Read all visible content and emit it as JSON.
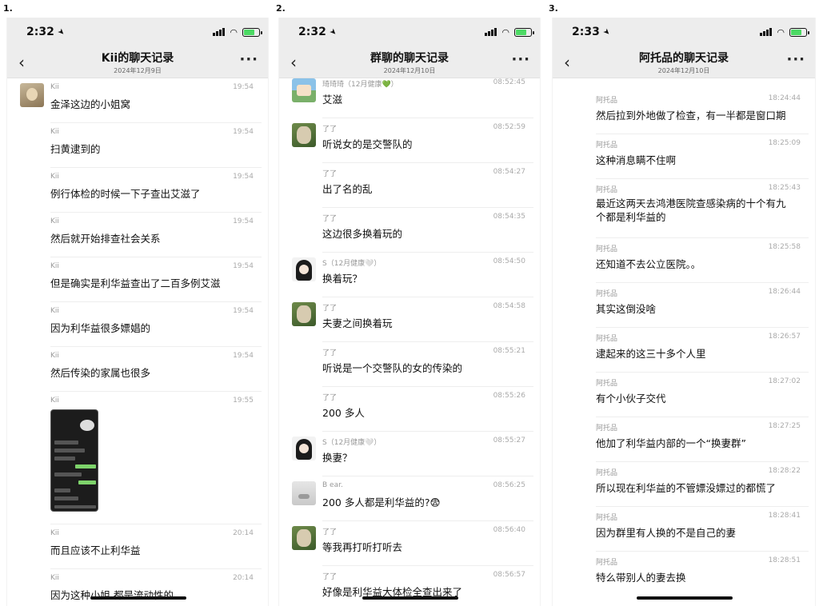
{
  "panels": [
    {
      "number": "1.",
      "status_time": "2:32",
      "title": "Kii的聊天记录",
      "date": "2024年12月9日",
      "messages": [
        {
          "sender": "Kii",
          "time": "19:54",
          "text": "金泽这边的小姐窝",
          "avatar": "face"
        },
        {
          "sender": "Kii",
          "time": "19:54",
          "text": "扫黄逮到的"
        },
        {
          "sender": "Kii",
          "time": "19:54",
          "text": "例行体检的时候一下子查出艾滋了"
        },
        {
          "sender": "Kii",
          "time": "19:54",
          "text": "然后就开始排查社会关系"
        },
        {
          "sender": "Kii",
          "time": "19:54",
          "text": "但是确实是利华益查出了二百多例艾滋"
        },
        {
          "sender": "Kii",
          "time": "19:54",
          "text": "因为利华益很多嫖娼的"
        },
        {
          "sender": "Kii",
          "time": "19:54",
          "text": "然后传染的家属也很多"
        },
        {
          "sender": "Kii",
          "time": "19:55",
          "text": "",
          "image": true
        },
        {
          "sender": "Kii",
          "time": "20:14",
          "text": "而且应该不止利华益"
        },
        {
          "sender": "Kii",
          "time": "20:14",
          "text": "因为这种小姐 都是流动性的"
        }
      ]
    },
    {
      "number": "2.",
      "status_time": "2:32",
      "title": "群聊的聊天记录",
      "date": "2024年12月10日",
      "messages": [
        {
          "sender": "琦琦琦（12月健康💚）",
          "time": "08:52:45",
          "text": "艾滋",
          "avatar": "kids"
        },
        {
          "sender": "了了",
          "time": "08:52:59",
          "text": "听说女的是交警队的",
          "avatar": "green"
        },
        {
          "sender": "了了",
          "time": "08:54:27",
          "text": "出了名的乱"
        },
        {
          "sender": "了了",
          "time": "08:54:35",
          "text": "这边很多换着玩的"
        },
        {
          "sender": "S（12月健康🤍）",
          "time": "08:54:50",
          "text": "换着玩？",
          "avatar": "girl"
        },
        {
          "sender": "了了",
          "time": "08:54:58",
          "text": "夫妻之间换着玩",
          "avatar": "green"
        },
        {
          "sender": "了了",
          "time": "08:55:21",
          "text": "听说是一个交警队的女的传染的"
        },
        {
          "sender": "了了",
          "time": "08:55:26",
          "text": "200 多人"
        },
        {
          "sender": "S（12月健康🤍）",
          "time": "08:55:27",
          "text": "换妻？",
          "avatar": "girl"
        },
        {
          "sender": "B ear.",
          "time": "08:56:25",
          "text": "200 多人都是利华益的?😨",
          "avatar": "bear"
        },
        {
          "sender": "了了",
          "time": "08:56:40",
          "text": "等我再打听打听去",
          "avatar": "green"
        },
        {
          "sender": "了了",
          "time": "08:56:57",
          "text": "好像是利华益大体检全查出来了"
        }
      ]
    },
    {
      "number": "3.",
      "status_time": "2:33",
      "title": "阿托品的聊天记录",
      "date": "2024年12月10日",
      "messages": [
        {
          "sender": "阿托品",
          "time": "18:24:44",
          "text": "然后拉到外地做了检查，有一半都是窗口期"
        },
        {
          "sender": "阿托品",
          "time": "18:25:09",
          "text": "这种消息瞒不住啊"
        },
        {
          "sender": "阿托品",
          "time": "18:25:43",
          "text": "最近这两天去鸿港医院查感染病的十个有九个都是利华益的",
          "wrap": true
        },
        {
          "sender": "阿托品",
          "time": "18:25:58",
          "text": "还知道不去公立医院。。"
        },
        {
          "sender": "阿托品",
          "time": "18:26:44",
          "text": "其实这倒没啥"
        },
        {
          "sender": "阿托品",
          "time": "18:26:57",
          "text": "逮起来的这三十多个人里"
        },
        {
          "sender": "阿托品",
          "time": "18:27:02",
          "text": "有个小伙子交代"
        },
        {
          "sender": "阿托品",
          "time": "18:27:25",
          "text": "他加了利华益内部的一个“换妻群”"
        },
        {
          "sender": "阿托品",
          "time": "18:28:22",
          "text": "所以现在利华益的不管嫖没嫖过的都慌了"
        },
        {
          "sender": "阿托品",
          "time": "18:28:41",
          "text": "因为群里有人换的不是自己的妻"
        },
        {
          "sender": "阿托品",
          "time": "18:28:51",
          "text": "特么带别人的妻去换"
        }
      ]
    }
  ]
}
